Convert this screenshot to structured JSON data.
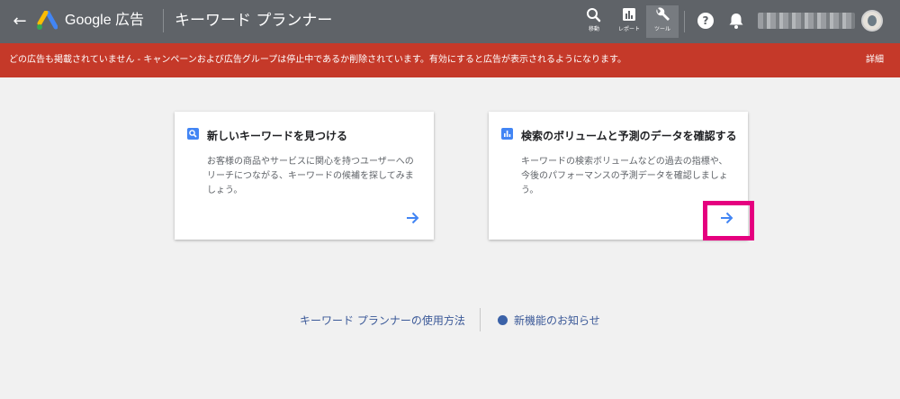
{
  "header": {
    "back_label": "←",
    "brand": "Google 広告",
    "page_title": "キーワード プランナー",
    "tools": [
      {
        "label": "移動",
        "icon": "search-icon"
      },
      {
        "label": "レポート",
        "icon": "reports-icon"
      },
      {
        "label": "ツール",
        "icon": "wrench-icon"
      }
    ],
    "help_label": "?",
    "colors": {
      "bar": "#5f6368",
      "alert": "#c53929",
      "accent": "#4285f4",
      "highlight": "#e5007f"
    }
  },
  "alert": {
    "message": "どの広告も掲載されていません - キャンペーンおよび広告グループは停止中であるか削除されています。有効にすると広告が表示されるようになります。",
    "action": "詳細"
  },
  "cards": [
    {
      "icon": "search-icon",
      "title": "新しいキーワードを見つける",
      "description": "お客様の商品やサービスに関心を持つユーザーへのリーチにつながる、キーワードの候補を探してみましょう。"
    },
    {
      "icon": "bar-chart-icon",
      "title": "検索のボリュームと予測のデータを確認する",
      "description": "キーワードの検索ボリュームなどの過去の指標や、今後のパフォーマンスの予測データを確認しましょう。"
    }
  ],
  "footer": {
    "guide_link": "キーワード プランナーの使用方法",
    "news_link": "新機能のお知らせ"
  }
}
